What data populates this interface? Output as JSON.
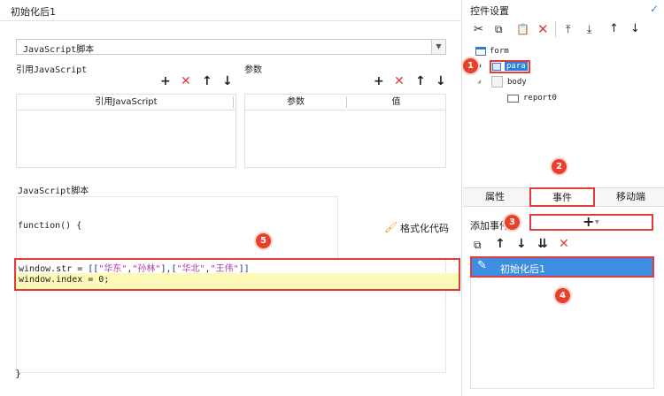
{
  "left": {
    "title": "初始化后1",
    "script_type": "JavaScript脚本",
    "ref_js_label": "引用JavaScript",
    "params_label": "参数",
    "ref_table_header": "引用JavaScript",
    "params_table_headers": [
      "参数",
      "值"
    ],
    "script_section_label": "JavaScript脚本",
    "function_sig": "function() {",
    "format_label": "格式化代码",
    "code_lines": [
      {
        "prefix": "window.str = ",
        "bracket_open": "[[",
        "s1": "\"华东\"",
        "c1": ",",
        "s2": "\"孙林\"",
        "mid": "],[",
        "s3": "\"华北\"",
        "c2": ",",
        "s4": "\"王伟\"",
        "bracket_close": "]]"
      },
      {
        "text": "window.index = 0;"
      }
    ],
    "closing_brace": "}"
  },
  "right": {
    "title": "控件设置",
    "tree": [
      {
        "label": "form"
      },
      {
        "label": "para"
      },
      {
        "label": "body"
      },
      {
        "label": "report0"
      }
    ],
    "tabs": [
      "属性",
      "事件",
      "移动端"
    ],
    "add_event_label": "添加事件",
    "add_button": "+",
    "events": [
      "初始化后1"
    ]
  },
  "callouts": [
    "1",
    "2",
    "3",
    "4",
    "5"
  ],
  "colors": {
    "accent_blue": "#3a86d6",
    "callout_red": "#e8402a",
    "highlight_yellow": "#fdf9b6",
    "selection_blue": "#2b7de0"
  }
}
